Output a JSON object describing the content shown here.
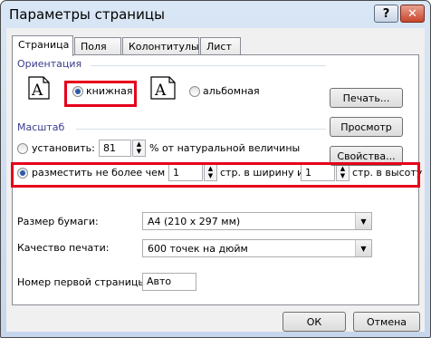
{
  "window": {
    "title": "Параметры страницы",
    "help": "?",
    "close": "✕"
  },
  "tabs": [
    {
      "label": "Страница"
    },
    {
      "label": "Поля"
    },
    {
      "label": "Колонтитулы"
    },
    {
      "label": "Лист"
    }
  ],
  "orientation": {
    "group_label": "Ориентация",
    "portrait_label": "книжная",
    "landscape_label": "альбомная",
    "selected": "portrait",
    "icon_letter": "A"
  },
  "scaling": {
    "group_label": "Масштаб",
    "adjust_label": "установить:",
    "adjust_value": "81",
    "adjust_suffix": "% от натуральной величины",
    "fit_label": "разместить не более чем на:",
    "fit_wide_value": "1",
    "fit_wide_suffix": "стр. в ширину и",
    "fit_tall_value": "1",
    "fit_tall_suffix": "стр. в высоту",
    "selected": "fit"
  },
  "paper": {
    "label": "Размер бумаги:",
    "value": "A4 (210 x 297 мм)"
  },
  "quality": {
    "label": "Качество печати:",
    "value": "600 точек на дюйм"
  },
  "first_page": {
    "label": "Номер первой страницы:",
    "value": "Авто"
  },
  "side_buttons": {
    "print": "Печать...",
    "preview": "Просмотр",
    "properties": "Свойства..."
  },
  "footer": {
    "ok": "ОК",
    "cancel": "Отмена"
  },
  "highlight_color": "#e5001a"
}
